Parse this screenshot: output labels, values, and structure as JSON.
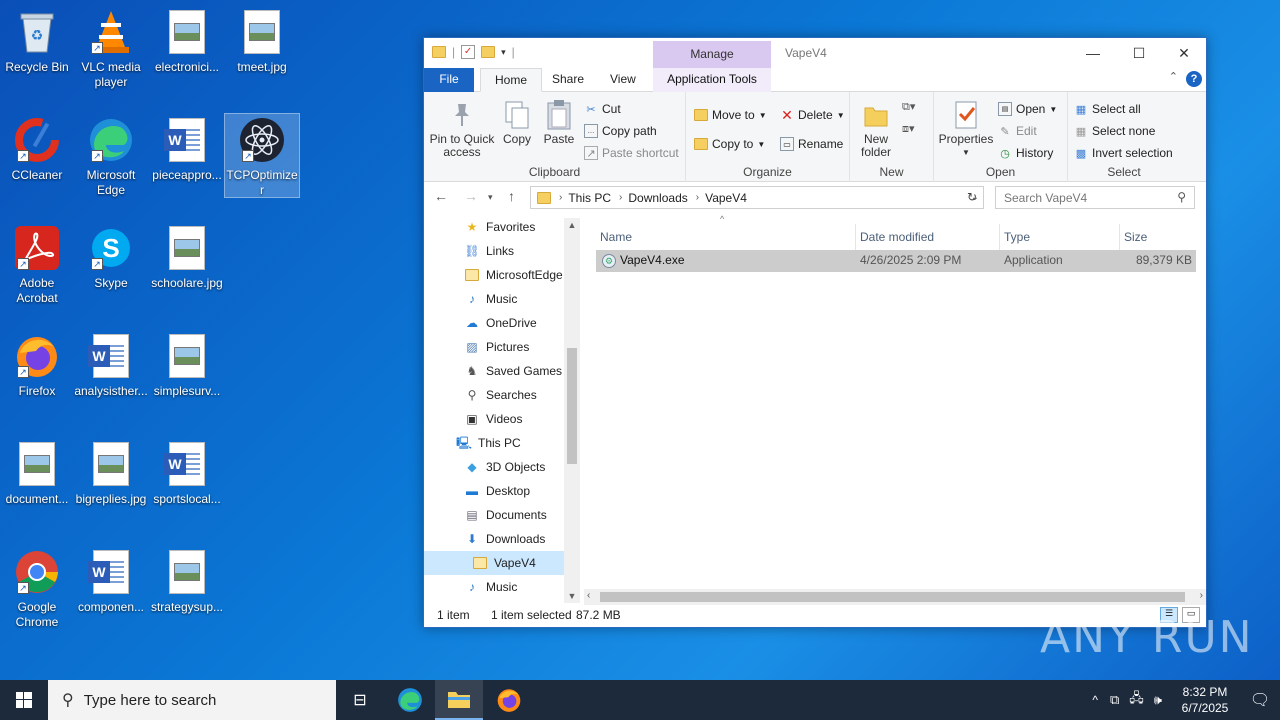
{
  "desktop": {
    "icons": [
      {
        "label": "Recycle Bin"
      },
      {
        "label": "VLC media player"
      },
      {
        "label": "electronici..."
      },
      {
        "label": "tmeet.jpg"
      },
      {
        "label": "CCleaner"
      },
      {
        "label": "Microsoft Edge"
      },
      {
        "label": "pieceappro..."
      },
      {
        "label": "TCPOptimizer"
      },
      {
        "label": "Adobe Acrobat"
      },
      {
        "label": "Skype"
      },
      {
        "label": "schoolare.jpg"
      },
      {
        "label": "Firefox"
      },
      {
        "label": "analysisther..."
      },
      {
        "label": "simplesurv..."
      },
      {
        "label": "document..."
      },
      {
        "label": "bigreplies.jpg"
      },
      {
        "label": "sportslocal..."
      },
      {
        "label": "Google Chrome"
      },
      {
        "label": "componen..."
      },
      {
        "label": "strategysup..."
      }
    ]
  },
  "explorer": {
    "title": "VapeV4",
    "contextual_tab_group": "Manage",
    "tabs": {
      "file": "File",
      "home": "Home",
      "share": "Share",
      "view": "View",
      "app_tools": "Application Tools"
    },
    "ribbon": {
      "clipboard": {
        "label": "Clipboard",
        "pin": "Pin to Quick access",
        "copy": "Copy",
        "paste": "Paste",
        "cut": "Cut",
        "copy_path": "Copy path",
        "paste_shortcut": "Paste shortcut"
      },
      "organize": {
        "label": "Organize",
        "move_to": "Move to",
        "copy_to": "Copy to",
        "delete": "Delete",
        "rename": "Rename"
      },
      "new": {
        "label": "New",
        "new_folder": "New folder"
      },
      "open": {
        "label": "Open",
        "properties": "Properties",
        "open": "Open",
        "edit": "Edit",
        "history": "History"
      },
      "select": {
        "label": "Select",
        "select_all": "Select all",
        "select_none": "Select none",
        "invert": "Invert selection"
      }
    },
    "address": {
      "crumbs": [
        "This PC",
        "Downloads",
        "VapeV4"
      ]
    },
    "search": {
      "placeholder": "Search VapeV4"
    },
    "nav_items": [
      {
        "label": "Favorites",
        "icon": "star-icon"
      },
      {
        "label": "Links",
        "icon": "links-icon"
      },
      {
        "label": "MicrosoftEdge",
        "icon": "folder-icon"
      },
      {
        "label": "Music",
        "icon": "music-icon"
      },
      {
        "label": "OneDrive",
        "icon": "cloud-icon"
      },
      {
        "label": "Pictures",
        "icon": "pictures-icon"
      },
      {
        "label": "Saved Games",
        "icon": "games-icon"
      },
      {
        "label": "Searches",
        "icon": "search-icon"
      },
      {
        "label": "Videos",
        "icon": "videos-icon"
      },
      {
        "label": "This PC",
        "icon": "computer-icon"
      },
      {
        "label": "3D Objects",
        "icon": "cube-icon"
      },
      {
        "label": "Desktop",
        "icon": "desktop-icon"
      },
      {
        "label": "Documents",
        "icon": "documents-icon"
      },
      {
        "label": "Downloads",
        "icon": "download-icon"
      },
      {
        "label": "VapeV4",
        "icon": "folder-icon"
      },
      {
        "label": "Music",
        "icon": "music-icon"
      }
    ],
    "columns": {
      "name": "Name",
      "date": "Date modified",
      "type": "Type",
      "size": "Size"
    },
    "files": [
      {
        "name": "VapeV4.exe",
        "date": "4/26/2025 2:09 PM",
        "type": "Application",
        "size": "89,379 KB"
      }
    ],
    "status": {
      "count": "1 item",
      "selected": "1 item selected",
      "size": "87.2 MB"
    }
  },
  "taskbar": {
    "search_placeholder": "Type here to search",
    "time": "8:32 PM",
    "date": "6/7/2025"
  },
  "watermark": "ANY RUN",
  "colors": {
    "accent": "#1a64c4",
    "selection": "#cccccc",
    "nav_selected": "#cce8ff",
    "manage_tab": "#d9c8f0"
  }
}
